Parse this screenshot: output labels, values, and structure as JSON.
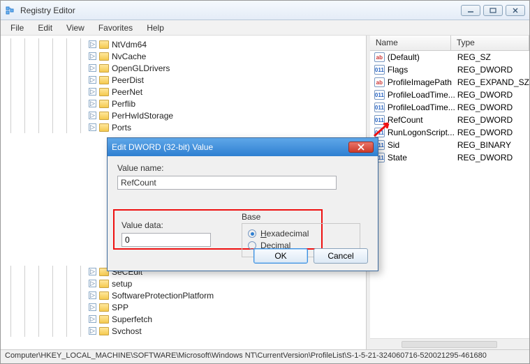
{
  "window": {
    "title": "Registry Editor"
  },
  "menu": {
    "file": "File",
    "edit": "Edit",
    "view": "View",
    "favorites": "Favorites",
    "help": "Help"
  },
  "tree": {
    "nodes": [
      "NtVdm64",
      "NvCache",
      "OpenGLDrivers",
      "PeerDist",
      "PeerNet",
      "Perflib",
      "PerHwIdStorage",
      "Ports",
      "SeCEdit",
      "setup",
      "SoftwareProtectionPlatform",
      "SPP",
      "Superfetch",
      "Svchost"
    ]
  },
  "list": {
    "cols": {
      "name": "Name",
      "type": "Type"
    },
    "rows": [
      {
        "icon": "str",
        "name": "(Default)",
        "type": "REG_SZ"
      },
      {
        "icon": "bin",
        "name": "Flags",
        "type": "REG_DWORD"
      },
      {
        "icon": "str",
        "name": "ProfileImagePath",
        "type": "REG_EXPAND_SZ"
      },
      {
        "icon": "bin",
        "name": "ProfileLoadTime...",
        "type": "REG_DWORD"
      },
      {
        "icon": "bin",
        "name": "ProfileLoadTime...",
        "type": "REG_DWORD"
      },
      {
        "icon": "bin",
        "name": "RefCount",
        "type": "REG_DWORD"
      },
      {
        "icon": "bin",
        "name": "RunLogonScript...",
        "type": "REG_DWORD"
      },
      {
        "icon": "bin",
        "name": "Sid",
        "type": "REG_BINARY"
      },
      {
        "icon": "bin",
        "name": "State",
        "type": "REG_DWORD"
      }
    ]
  },
  "dialog": {
    "title": "Edit DWORD (32-bit) Value",
    "valuename_label": "Value name:",
    "valuename": "RefCount",
    "valuedata_label": "Value data:",
    "valuedata": "0",
    "base_label": "Base",
    "hex": "Hexadecimal",
    "dec": "Decimal",
    "ok": "OK",
    "cancel": "Cancel"
  },
  "status": {
    "path": "Computer\\HKEY_LOCAL_MACHINE\\SOFTWARE\\Microsoft\\Windows NT\\CurrentVersion\\ProfileList\\S-1-5-21-324060716-520021295-461680"
  }
}
